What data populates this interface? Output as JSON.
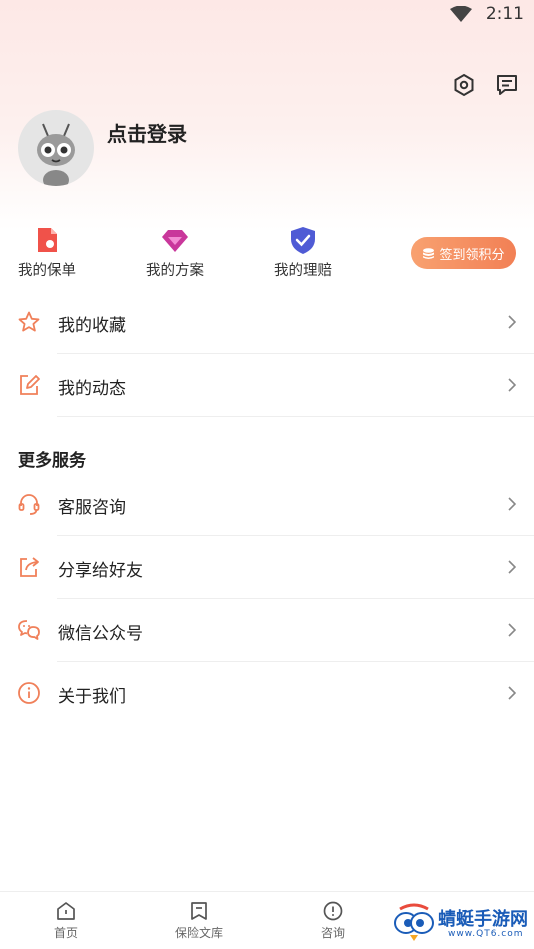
{
  "status": {
    "time": "2:11"
  },
  "profile": {
    "login_prompt": "点击登录"
  },
  "shortcuts": [
    {
      "label": "我的保单",
      "icon": "policy-doc-icon",
      "color": "#f0524a"
    },
    {
      "label": "我的方案",
      "icon": "diamond-icon",
      "color": "#c9379b"
    },
    {
      "label": "我的理赔",
      "icon": "shield-check-icon",
      "color": "#4f5bd5"
    }
  ],
  "signin": {
    "label": "签到领积分",
    "icon": "coin-stack-icon"
  },
  "menu": [
    {
      "label": "我的收藏",
      "icon": "star-icon"
    },
    {
      "label": "我的动态",
      "icon": "edit-icon"
    }
  ],
  "more_services": {
    "title": "更多服务",
    "items": [
      {
        "label": "客服咨询",
        "icon": "headset-icon"
      },
      {
        "label": "分享给好友",
        "icon": "share-icon"
      },
      {
        "label": "微信公众号",
        "icon": "wechat-icon"
      },
      {
        "label": "关于我们",
        "icon": "info-icon"
      }
    ]
  },
  "tabbar": [
    {
      "label": "首页",
      "icon": "home-icon"
    },
    {
      "label": "保险文库",
      "icon": "library-icon"
    },
    {
      "label": "咨询",
      "icon": "consult-icon"
    }
  ],
  "watermark": {
    "text": "蜻蜓手游网",
    "sub": "www.QT6.com"
  },
  "colors": {
    "accent": "#f28055",
    "icon_stroke": "#f0805a"
  }
}
